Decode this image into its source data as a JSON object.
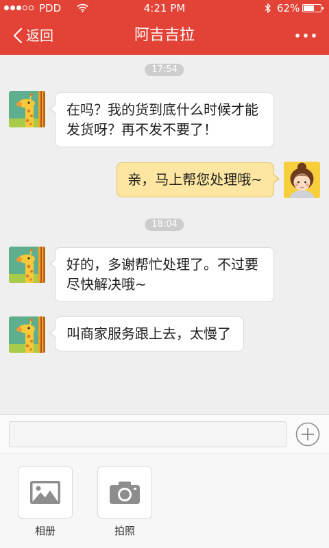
{
  "status_bar": {
    "signal_strength": 3,
    "signal_max": 5,
    "carrier": "PDD",
    "time": "4:21 PM",
    "battery_text": "62%",
    "battery_level": 0.62,
    "icons": {
      "wifi": "wifi-icon",
      "bluetooth": "bluetooth-icon",
      "battery": "battery-icon"
    }
  },
  "nav": {
    "back_icon": "chevron-left-icon",
    "back_label": "返回",
    "title": "阿吉吉拉",
    "more_icon": "more-dots-icon"
  },
  "chat": {
    "groups": [
      {
        "timestamp": "17:54",
        "messages": [
          {
            "outgoing": false,
            "text": "在吗？我的货到底什么时候才能发货呀？再不发不要了！"
          },
          {
            "outgoing": true,
            "text": "亲，马上帮您处理哦~"
          }
        ]
      },
      {
        "timestamp": "18:04",
        "messages": [
          {
            "outgoing": false,
            "text": "好的，多谢帮忙处理了。不过要尽快解决哦~"
          },
          {
            "outgoing": false,
            "text": "叫商家服务跟上去，太慢了"
          }
        ]
      }
    ]
  },
  "composer": {
    "input_value": "",
    "plus_icon": "plus-circle-icon"
  },
  "panel": {
    "items": [
      {
        "label": "相册",
        "icon": "image-icon"
      },
      {
        "label": "拍照",
        "icon": "camera-icon"
      }
    ]
  },
  "colors": {
    "header_red": "#e24336",
    "chat_background": "#efefef",
    "incoming_bubble": "#ffffff",
    "outgoing_bubble": "#fde6a1",
    "timestamp_pill": "#cdcdcd"
  }
}
